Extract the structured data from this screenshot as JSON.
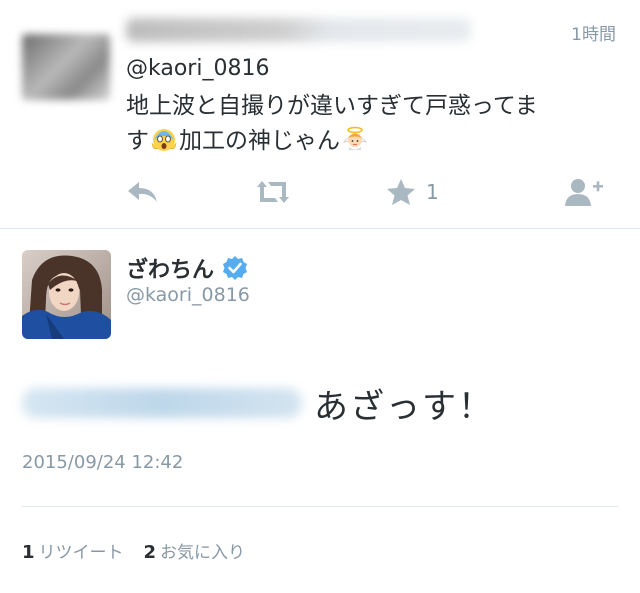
{
  "reply_tweet": {
    "time": "1時間",
    "mention": "@kaori_0816",
    "text_line1": "地上波と自撮りが違いすぎて戸惑ってま",
    "text_line2_a": "す",
    "text_line2_b": "加工の神じゃん",
    "emojis": [
      "scream-emoji",
      "angel-emoji"
    ],
    "favorite_count": "1",
    "icons": [
      "reply-icon",
      "retweet-icon",
      "favorite-star-icon",
      "follow-user-icon"
    ]
  },
  "main_tweet": {
    "display_name": "ざわちん",
    "handle": "@kaori_0816",
    "text": "あざっす！",
    "date": "2015/09/24 12:42",
    "retweets_count": "1",
    "retweets_label": "リツイート",
    "favorites_count": "2",
    "favorites_label": "お気に入り",
    "verified": true
  },
  "colors": {
    "text": "#292f33",
    "muted": "#8899a6",
    "icon": "#aab8c2",
    "verified": "#55acee",
    "divider": "#e1e8ed"
  }
}
